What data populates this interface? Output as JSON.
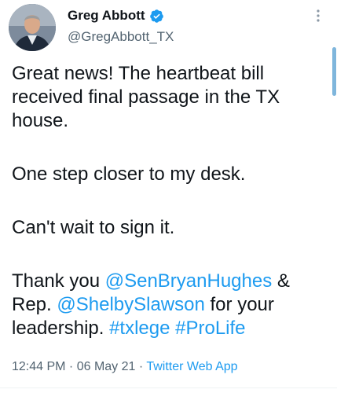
{
  "author": {
    "display_name": "Greg Abbott",
    "handle": "@GregAbbott_TX",
    "verified": true,
    "avatar_icon": "profile-photo"
  },
  "tweet": {
    "line1": "Great news! The heartbeat bill received final passage in the TX house.",
    "line2": "One step closer to my desk.",
    "line3": "Can't wait to sign it.",
    "line4_prefix": "Thank you ",
    "mention1": "@SenBryanHughes",
    "line4_mid": " & Rep. ",
    "mention2": "@ShelbySlawson",
    "line4_suffix": " for your leadership. ",
    "hashtag1": "#txlege",
    "line4_space": " ",
    "hashtag2": "#ProLife"
  },
  "meta": {
    "time": "12:44 PM",
    "sep1": " · ",
    "date": "06 May 21",
    "sep2": " · ",
    "app": "Twitter Web App"
  },
  "colors": {
    "link": "#1d9bf0",
    "verified": "#1d9bf0",
    "secondary_text": "#536471",
    "primary_text": "#0f1419"
  },
  "icons": {
    "verified": "verified-badge-icon",
    "more": "more-vertical-icon"
  }
}
